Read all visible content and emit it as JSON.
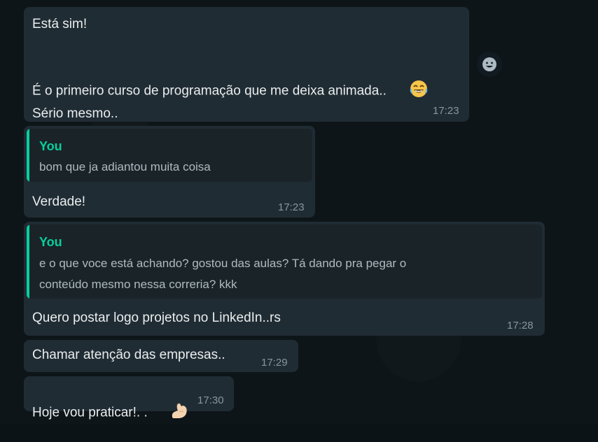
{
  "messages": [
    {
      "lines": [
        "Está sim!",
        "",
        "É o primeiro curso de programação que me deixa animada..",
        "",
        "Sério mesmo.."
      ],
      "emoji": "laughing-face",
      "time": "17:23"
    },
    {
      "quote_author": "You",
      "quote_text": "bom que ja adiantou muita coisa",
      "text": "Verdade!",
      "time": "17:23"
    },
    {
      "quote_author": "You",
      "quote_text_line1": "e o que voce está achando? gostou das aulas? Tá dando pra pegar o",
      "quote_text_line2": "conteúdo mesmo nessa correria? kkk",
      "text": "Quero postar logo projetos no LinkedIn..rs",
      "time": "17:28"
    },
    {
      "text": "Chamar atenção das empresas..",
      "time": "17:29"
    },
    {
      "text": "Hoje vou praticar!. .",
      "emoji": "flexed-biceps",
      "time": "17:30"
    }
  ],
  "colors": {
    "bubble": "#202c33",
    "quote_accent": "#06cf9c",
    "background": "#0e1519"
  }
}
